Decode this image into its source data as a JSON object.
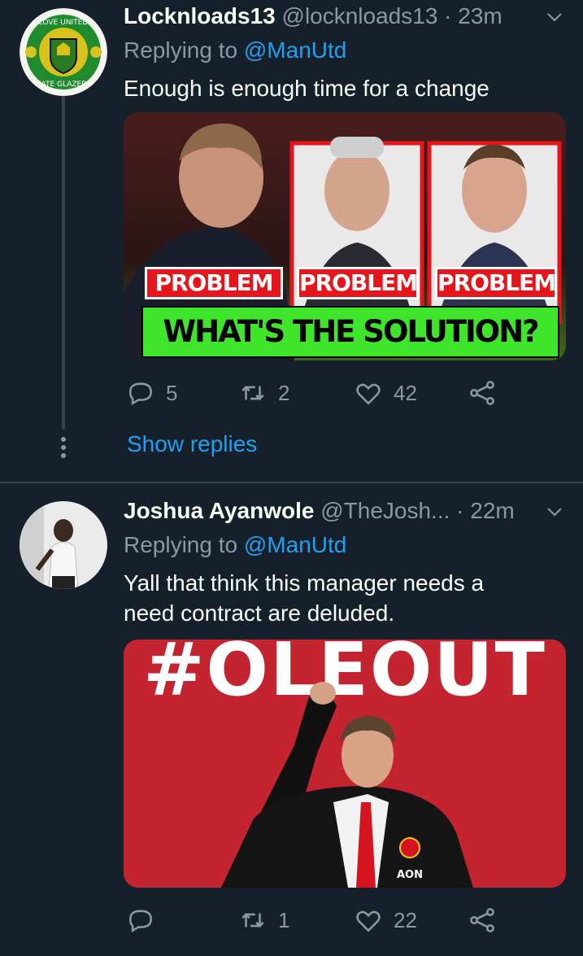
{
  "tweets": [
    {
      "display_name": "Locknloads13",
      "handle": "@locknloads13",
      "time": "· 23m",
      "replying_prefix": "Replying to",
      "replying_mention": "@ManUtd",
      "text": "Enough is enough time for a change",
      "avatar_text_top": "LOVE UNITED",
      "avatar_text_bottom": "HATE GLAZERS",
      "media": {
        "problem_labels": [
          "PROBLEM",
          "PROBLEM",
          "PROBLEM"
        ],
        "solution_label": "WHAT'S THE SOLUTION?"
      },
      "actions": {
        "replies": "5",
        "retweets": "2",
        "likes": "42"
      },
      "show_replies": "Show replies"
    },
    {
      "display_name": "Joshua Ayanwole",
      "handle": "@TheJosh...",
      "time": "· 22m",
      "replying_prefix": "Replying to",
      "replying_mention": "@ManUtd",
      "text": "Yall that think this manager needs a need contract are deluded.",
      "media": {
        "headline": "#OLEOUT",
        "badge": "AON"
      },
      "actions": {
        "replies": "",
        "retweets": "1",
        "likes": "22"
      }
    }
  ],
  "colors": {
    "background": "#15202b",
    "accent": "#1da1f2",
    "muted": "#8899a6",
    "divider": "#38444d"
  }
}
